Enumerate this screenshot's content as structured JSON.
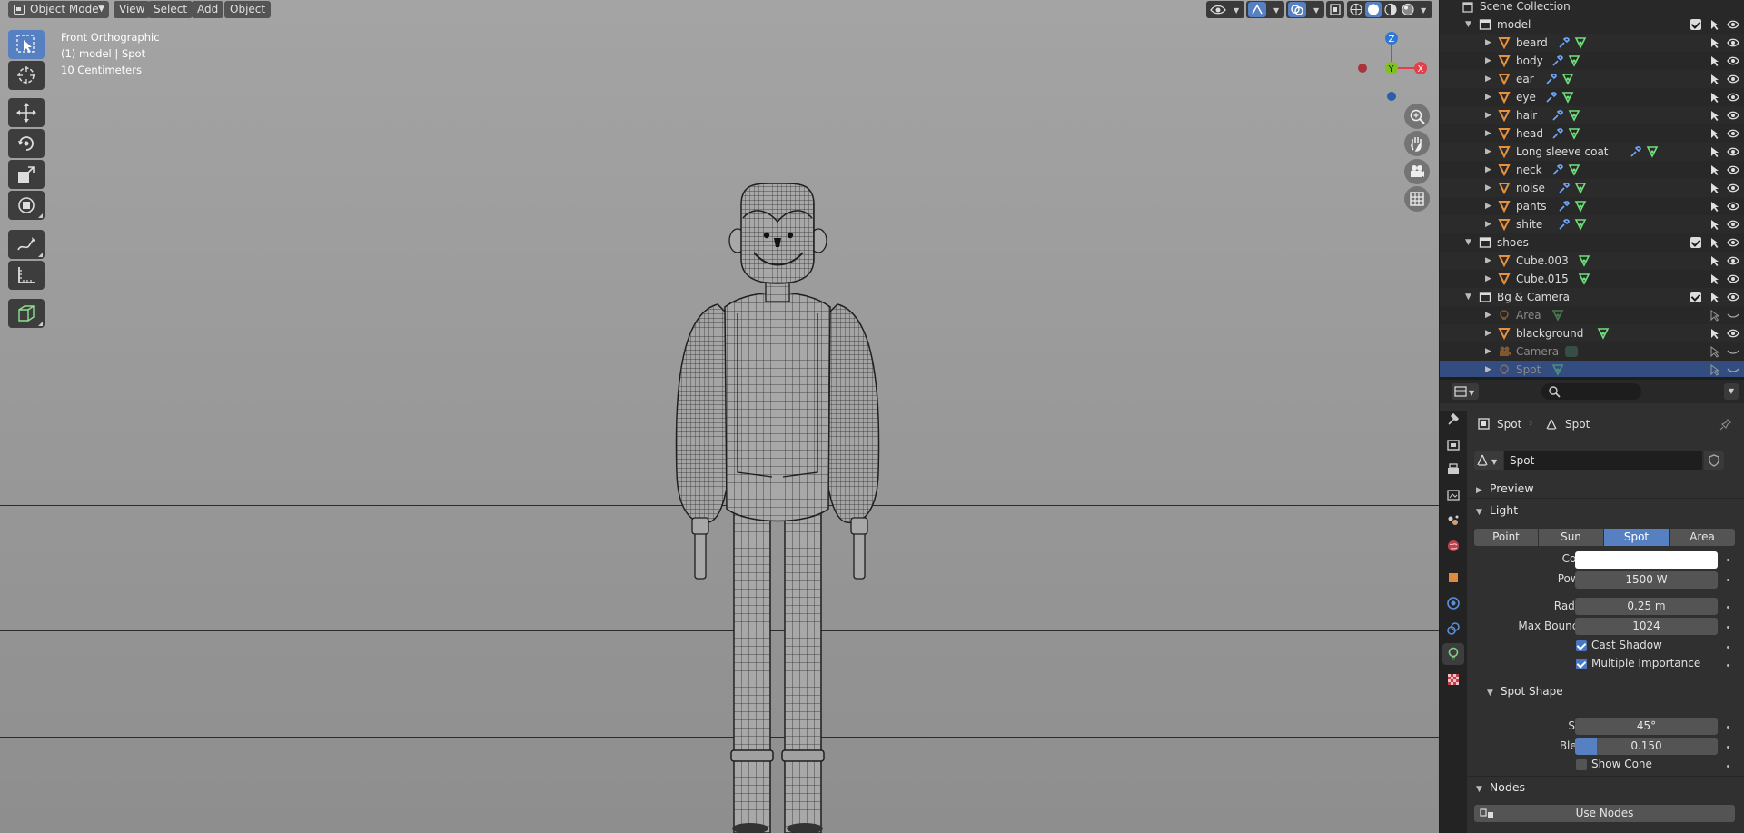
{
  "header": {
    "mode": "Object Mode",
    "menus": [
      "View",
      "Select",
      "Add",
      "Object"
    ]
  },
  "viewport": {
    "view_name": "Front Orthographic",
    "context": "(1) model | Spot",
    "scale": "10 Centimeters",
    "gizmo": {
      "z": "Z",
      "y": "Y",
      "x": "X"
    }
  },
  "outliner": {
    "root": "Scene Collection",
    "rows": [
      {
        "name": "model",
        "kind": "collection",
        "level": 1
      },
      {
        "name": "beard",
        "kind": "mesh",
        "level": 2,
        "mods": true
      },
      {
        "name": "body",
        "kind": "mesh",
        "level": 2,
        "mods": true
      },
      {
        "name": "ear",
        "kind": "mesh",
        "level": 2,
        "mods": true
      },
      {
        "name": "eye",
        "kind": "mesh",
        "level": 2,
        "mods": true
      },
      {
        "name": "hair",
        "kind": "mesh",
        "level": 2,
        "mods": true
      },
      {
        "name": "head",
        "kind": "mesh",
        "level": 2,
        "mods": true
      },
      {
        "name": "Long sleeve coat",
        "kind": "mesh",
        "level": 2,
        "mods": true
      },
      {
        "name": "neck",
        "kind": "mesh",
        "level": 2,
        "mods": true
      },
      {
        "name": "noise",
        "kind": "mesh",
        "level": 2,
        "mods": true
      },
      {
        "name": "pants",
        "kind": "mesh",
        "level": 2,
        "mods": true
      },
      {
        "name": "shite",
        "kind": "mesh",
        "level": 2,
        "mods": true
      },
      {
        "name": "shoes",
        "kind": "collection",
        "level": 1
      },
      {
        "name": "Cube.003",
        "kind": "mesh",
        "level": 2,
        "mods": false
      },
      {
        "name": "Cube.015",
        "kind": "mesh",
        "level": 2,
        "mods": false
      },
      {
        "name": "Bg & Camera",
        "kind": "collection",
        "level": 1
      },
      {
        "name": "Area",
        "kind": "light",
        "level": 2,
        "dim": true
      },
      {
        "name": "blackground",
        "kind": "mesh",
        "level": 2,
        "mods": false
      },
      {
        "name": "Camera",
        "kind": "camera",
        "level": 2,
        "dim": true
      },
      {
        "name": "Spot",
        "kind": "light",
        "level": 2,
        "dim": true,
        "selected": true
      }
    ]
  },
  "properties": {
    "breadcrumb_object": "Spot",
    "breadcrumb_data": "Spot",
    "datablock": "Spot",
    "preview_label": "Preview",
    "light_label": "Light",
    "light_types": [
      "Point",
      "Sun",
      "Spot",
      "Area"
    ],
    "selected_type": "Spot",
    "color_label": "Color",
    "power_label": "Power",
    "power_value": "1500 W",
    "radius_label": "Radius",
    "radius_value": "0.25 m",
    "bounces_label": "Max Bounces",
    "bounces_value": "1024",
    "cast_shadow": "Cast Shadow",
    "multiple_importance": "Multiple Importance",
    "spot_shape_label": "Spot Shape",
    "size_label": "Size",
    "size_value": "45°",
    "blend_label": "Blend",
    "blend_value": "0.150",
    "blend_fraction": 0.15,
    "show_cone": "Show Cone",
    "nodes_label": "Nodes",
    "use_nodes": "Use Nodes"
  }
}
